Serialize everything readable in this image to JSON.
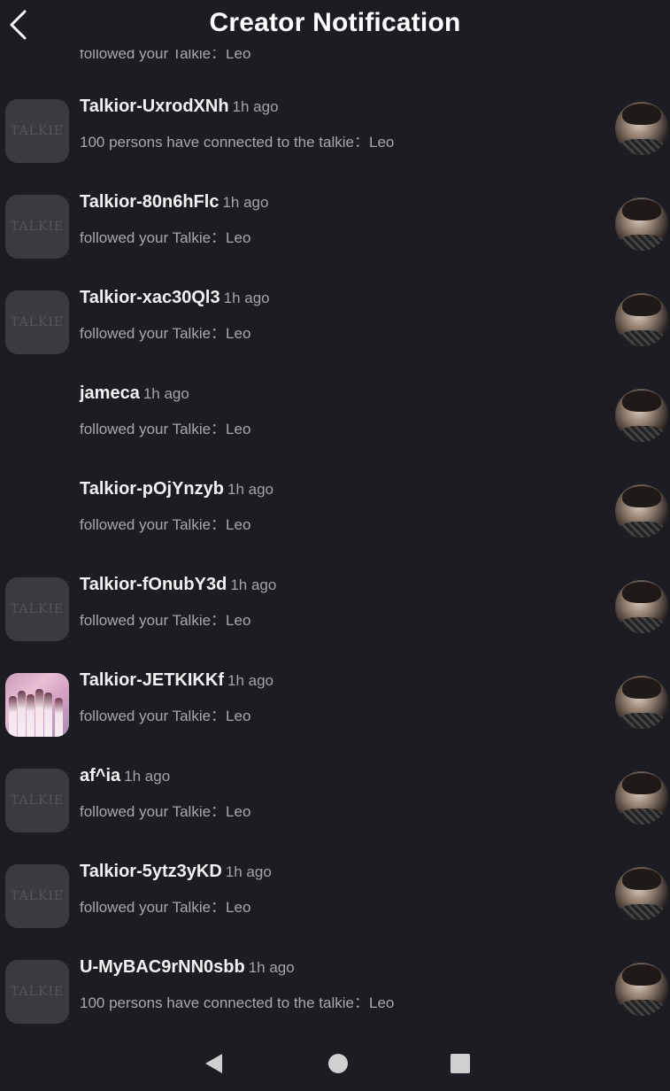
{
  "header": {
    "title": "Creator Notification"
  },
  "partial_row": {
    "message": "followed your Talkie：Leo"
  },
  "notifications": [
    {
      "username": "Talkior-UxrodXNh",
      "time": "1h ago",
      "message": "100 persons have connected to the talkie：Leo",
      "avatar": "default",
      "avatar_text": "TALKIE"
    },
    {
      "username": "Talkior-80n6hFlc",
      "time": "1h ago",
      "message": "followed your Talkie：Leo",
      "avatar": "default",
      "avatar_text": "TALKIE"
    },
    {
      "username": "Talkior-xac30Ql3",
      "time": "1h ago",
      "message": "followed your Talkie：Leo",
      "avatar": "default",
      "avatar_text": "TALKIE"
    },
    {
      "username": "jameca",
      "time": "1h ago",
      "message": "followed your Talkie：Leo",
      "avatar": "none",
      "avatar_text": ""
    },
    {
      "username": "Talkior-pOjYnzyb",
      "time": "1h ago",
      "message": "followed your Talkie：Leo",
      "avatar": "none",
      "avatar_text": ""
    },
    {
      "username": "Talkior-fOnubY3d",
      "time": "1h ago",
      "message": "followed your Talkie：Leo",
      "avatar": "default",
      "avatar_text": "TALKIE"
    },
    {
      "username": "Talkior-JETKIKKf",
      "time": "1h ago",
      "message": "followed your Talkie：Leo",
      "avatar": "photo",
      "avatar_text": ""
    },
    {
      "username": "af^ia",
      "time": "1h ago",
      "message": "followed your Talkie：Leo",
      "avatar": "default",
      "avatar_text": "TALKIE"
    },
    {
      "username": "Talkior-5ytz3yKD",
      "time": "1h ago",
      "message": "followed your Talkie：Leo",
      "avatar": "default",
      "avatar_text": "TALKIE"
    },
    {
      "username": "U-MyBAC9rNN0sbb",
      "time": "1h ago",
      "message": "100 persons have connected to the talkie：Leo",
      "avatar": "default",
      "avatar_text": "TALKIE"
    }
  ],
  "navbar": {
    "icons": [
      "back-triangle-icon",
      "home-circle-icon",
      "recents-square-icon"
    ]
  },
  "colors": {
    "background": "#1b1d22",
    "username": "#f2f2f2",
    "secondary_text": "#a7a8ac"
  }
}
